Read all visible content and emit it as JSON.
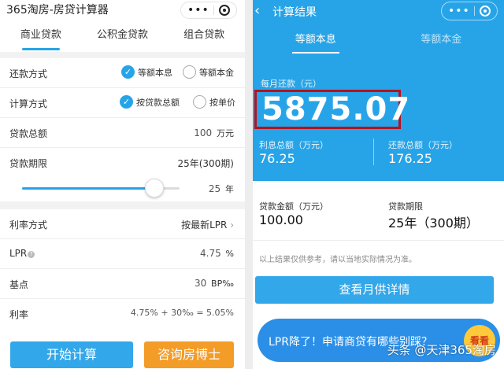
{
  "left": {
    "title": "365淘房-房贷计算器",
    "tabs": [
      "商业贷款",
      "公积金贷款",
      "组合贷款"
    ],
    "repay_method": {
      "label": "还款方式",
      "options": [
        "等额本息",
        "等额本金"
      ],
      "selected": 0
    },
    "calc_method": {
      "label": "计算方式",
      "options": [
        "按贷款总额",
        "按单价"
      ],
      "selected": 0
    },
    "loan_total": {
      "label": "贷款总额",
      "value": "100",
      "unit": "万元"
    },
    "loan_term": {
      "label": "贷款期限",
      "value": "25年(300期)",
      "slider_value": "25",
      "slider_unit": "年",
      "slider_fraction": 0.84
    },
    "rate_method": {
      "label": "利率方式",
      "value": "按最新LPR"
    },
    "lpr": {
      "label": "LPR",
      "value": "4.75",
      "unit": "%"
    },
    "basis": {
      "label": "基点",
      "value": "30",
      "unit": "BP‰"
    },
    "rate": {
      "label": "利率",
      "value": "4.75% + 30‰ = 5.05%"
    },
    "buttons": {
      "start": "开始计算",
      "consult": "咨询房博士"
    }
  },
  "right": {
    "title": "计算结果",
    "tabs": [
      "等额本息",
      "等额本金"
    ],
    "monthly_label": "每月还款（元）",
    "monthly_value": "5875.07",
    "interest_label": "利息总额（万元）",
    "interest_value": "76.25",
    "repay_total_label": "还款总额（万元）",
    "repay_total_value": "176.25",
    "loan_amount_label": "贷款金额（万元）",
    "loan_amount_value": "100.00",
    "loan_term_label": "贷款期限",
    "loan_term_value": "25年（300期）",
    "note": "以上结果仅供参考，请以当地实际情况为准。",
    "detail_button": "查看月供详情",
    "banner_text": "LPR降了！申请商贷有哪些别踩？",
    "banner_badge": "看看",
    "watermark": "头条 @天津365淘房"
  },
  "colors": {
    "accent": "#27a4e8",
    "orange": "#f39c27",
    "highlight_box": "#b5121b"
  }
}
